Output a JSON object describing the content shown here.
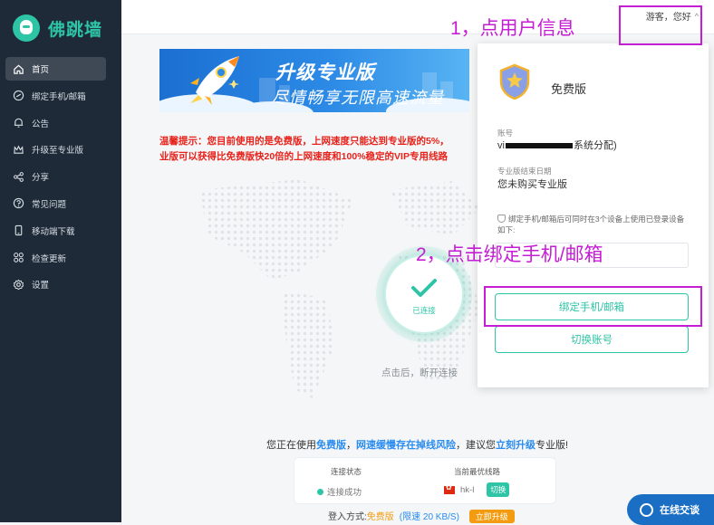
{
  "app": {
    "name": "佛跳墙"
  },
  "sidebar": {
    "items": [
      {
        "label": "首页",
        "icon": "home-icon",
        "active": true
      },
      {
        "label": "绑定手机/邮箱",
        "icon": "link-icon"
      },
      {
        "label": "公告",
        "icon": "bell-icon"
      },
      {
        "label": "升级至专业版",
        "icon": "crown-icon"
      },
      {
        "label": "分享",
        "icon": "share-icon"
      },
      {
        "label": "常见问题",
        "icon": "question-icon"
      },
      {
        "label": "移动端下载",
        "icon": "mobile-icon"
      },
      {
        "label": "检查更新",
        "icon": "grid-icon"
      },
      {
        "label": "设置",
        "icon": "gear-icon"
      }
    ]
  },
  "topbar": {
    "greeting": "游客，您好",
    "caret": "^"
  },
  "banner": {
    "title": "升级专业版",
    "subtitle": "尽情畅享无限高速流量"
  },
  "notice": {
    "line1": "温馨提示：您目前使用的是免费版，上网速度只能达到专业版的5%，",
    "line2": "业版可以获得比免费版快20倍的上网速度和100%稳定的VIP专用线路"
  },
  "connection": {
    "state_label": "已连接",
    "hint": "点击后，断开连接"
  },
  "bottom": {
    "msg_prefix": "您正在使用",
    "msg_free": "免费版",
    "msg_comma": "，",
    "msg_risk": "网速缓慢存在掉线风险",
    "msg_mid": "，建议您",
    "msg_upgrade": "立刻升级",
    "msg_suffix": "专业版!",
    "status_header": "连接状态",
    "status_value": "连接成功",
    "line_header": "当前最优线路",
    "line_value": "hk-l",
    "switch_label": "切换",
    "login_prefix": "登入方式:",
    "login_free": "免费版",
    "login_speed": "(限速 20 KB/S)",
    "upgrade_label": "立即升级",
    "chat_label": "在线交谈"
  },
  "panel": {
    "plan_name": "免费版",
    "account_label": "账号",
    "account_prefix": "vi",
    "account_suffix": "系统分配)",
    "expiry_label": "专业版结束日期",
    "expiry_value": "您未购买专业版",
    "device_hint": "绑定手机/邮箱后可同时在3个设备上使用已登录设备如下:",
    "bind_button": "绑定手机/邮箱",
    "switch_account_button": "切换账号"
  },
  "annotations": {
    "step1": "1，点用户信息",
    "step2": "2，点击绑定手机/邮箱"
  },
  "colors": {
    "accent": "#2ec4a6",
    "sidebar": "#1e2a37",
    "annotation": "#c41dd4",
    "warning": "#e8221b"
  }
}
